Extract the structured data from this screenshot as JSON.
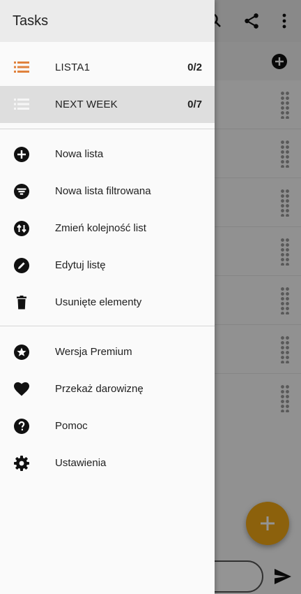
{
  "drawer": {
    "title": "Tasks",
    "lists": [
      {
        "name": "LISTA1",
        "count": "0/2",
        "icon": "list-icon",
        "selected": false,
        "icon_color": "#e0823d"
      },
      {
        "name": "NEXT WEEK",
        "count": "0/7",
        "icon": "list-icon",
        "selected": true,
        "icon_color": "#f5f5f5"
      }
    ],
    "actions": [
      {
        "label": "Nowa lista",
        "icon": "add-circle-icon"
      },
      {
        "label": "Nowa lista filtrowana",
        "icon": "filter-icon"
      },
      {
        "label": "Zmień kolejność list",
        "icon": "reorder-icon"
      },
      {
        "label": "Edytuj listę",
        "icon": "edit-icon"
      },
      {
        "label": "Usunięte elementy",
        "icon": "trash-icon"
      }
    ],
    "extras": [
      {
        "label": "Wersja Premium",
        "icon": "star-badge-icon"
      },
      {
        "label": "Przekaż darowiznę",
        "icon": "heart-icon"
      },
      {
        "label": "Pomoc",
        "icon": "help-icon"
      },
      {
        "label": "Ustawienia",
        "icon": "settings-icon"
      }
    ]
  },
  "colors": {
    "accent": "#e0823d",
    "fab": "#f2a816"
  }
}
